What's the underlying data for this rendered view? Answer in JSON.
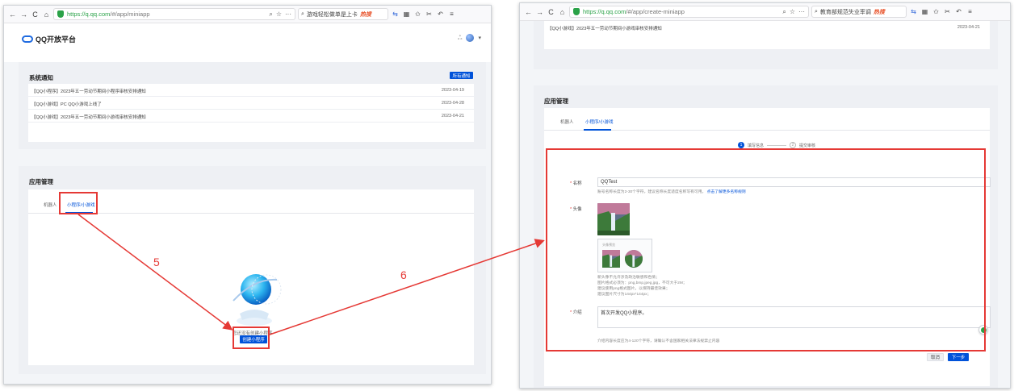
{
  "left_window": {
    "url_host": "https://q.qq.com",
    "url_path": "/#/app/miniapp",
    "search_text": "游戏轻松做单是上卡",
    "hot_label": "热搜",
    "logo_text": "QQ开放平台",
    "notices": {
      "title": "系统通知",
      "all_button": "所有通知",
      "items": [
        {
          "text": "【QQ小程序】2023年五一劳动节期间小程序审核安排通知",
          "date": "2023-04-19"
        },
        {
          "text": "【QQ小游戏】PC QQ小游戏上线了",
          "date": "2023-04-28"
        },
        {
          "text": "【QQ小游戏】2023年五一劳动节期间小游戏审核安排通知",
          "date": "2023-04-21"
        }
      ]
    },
    "app_mgmt": {
      "title": "应用管理",
      "tabs": [
        "机器人",
        "小程序/小游戏"
      ],
      "empty_text": "您还没有创建小程序",
      "create_button": "创建小程序"
    }
  },
  "annotations": {
    "step5": "5",
    "step6": "6"
  },
  "right_window": {
    "url_host": "https://q.qq.com",
    "url_path": "/#/app/create-miniapp",
    "search_text": "教育部规范失业率调",
    "hot_label": "热搜",
    "top_notice": {
      "text": "【QQ小游戏】2023年五一劳动节期间小游戏审核安排通知",
      "date": "2023-04-21"
    },
    "app_mgmt": {
      "title": "应用管理",
      "tabs": [
        "机器人",
        "小程序/小游戏"
      ]
    },
    "steps": [
      "填写信息",
      "提交审核"
    ],
    "form": {
      "name_label": "名称",
      "name_value": "QQTest",
      "name_help": "账号名称长度为2-30个字符，建议名称长度适度名称写有可用。",
      "name_help_link": "点击了解更多名称规则",
      "avatar_label": "头像",
      "preview_label": "头像预览",
      "avatar_help": [
        "新头像不允许涉及政治敏感和色情；",
        "图片格式必须为：png,bmp,jpeg,jpg，不可大于2M；",
        "建议使用png格式图片，以保持最佳效果；",
        "建议图片尺寸为144px*144px；"
      ],
      "intro_label": "介绍",
      "intro_value": "首次开发QQ小程序。",
      "intro_help": "介绍内容长度应为4-120个字符，请确认不含国家相关法律法规禁止内容",
      "cancel_button": "取消",
      "next_button": "下一步"
    }
  }
}
